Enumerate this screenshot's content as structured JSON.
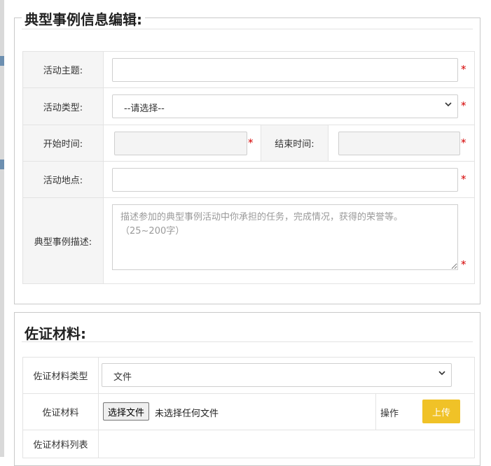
{
  "colors": {
    "required_star": "#d40000",
    "upload_button": "#f0c227"
  },
  "section1": {
    "title": "典型事例信息编辑:",
    "fields": {
      "theme_label": "活动主题:",
      "type_label": "活动类型:",
      "type_selected": "--请选择--",
      "start_label": "开始时间:",
      "end_label": "结束时间:",
      "location_label": "活动地点:",
      "desc_label": "典型事例描述:",
      "desc_placeholder": "描述参加的典型事例活动中你承担的任务，完成情况，获得的荣誉等。\n（25~200字）"
    },
    "required_mark": "*"
  },
  "section2": {
    "title": "佐证材料:",
    "material_type_label": "佐证材料类型",
    "material_type_selected": "文件",
    "material_label": "佐证材料",
    "choose_file_label": "选择文件",
    "file_status": "未选择任何文件",
    "operation_label": "操作",
    "upload_label": "上传",
    "material_list_label": "佐证材料列表"
  }
}
